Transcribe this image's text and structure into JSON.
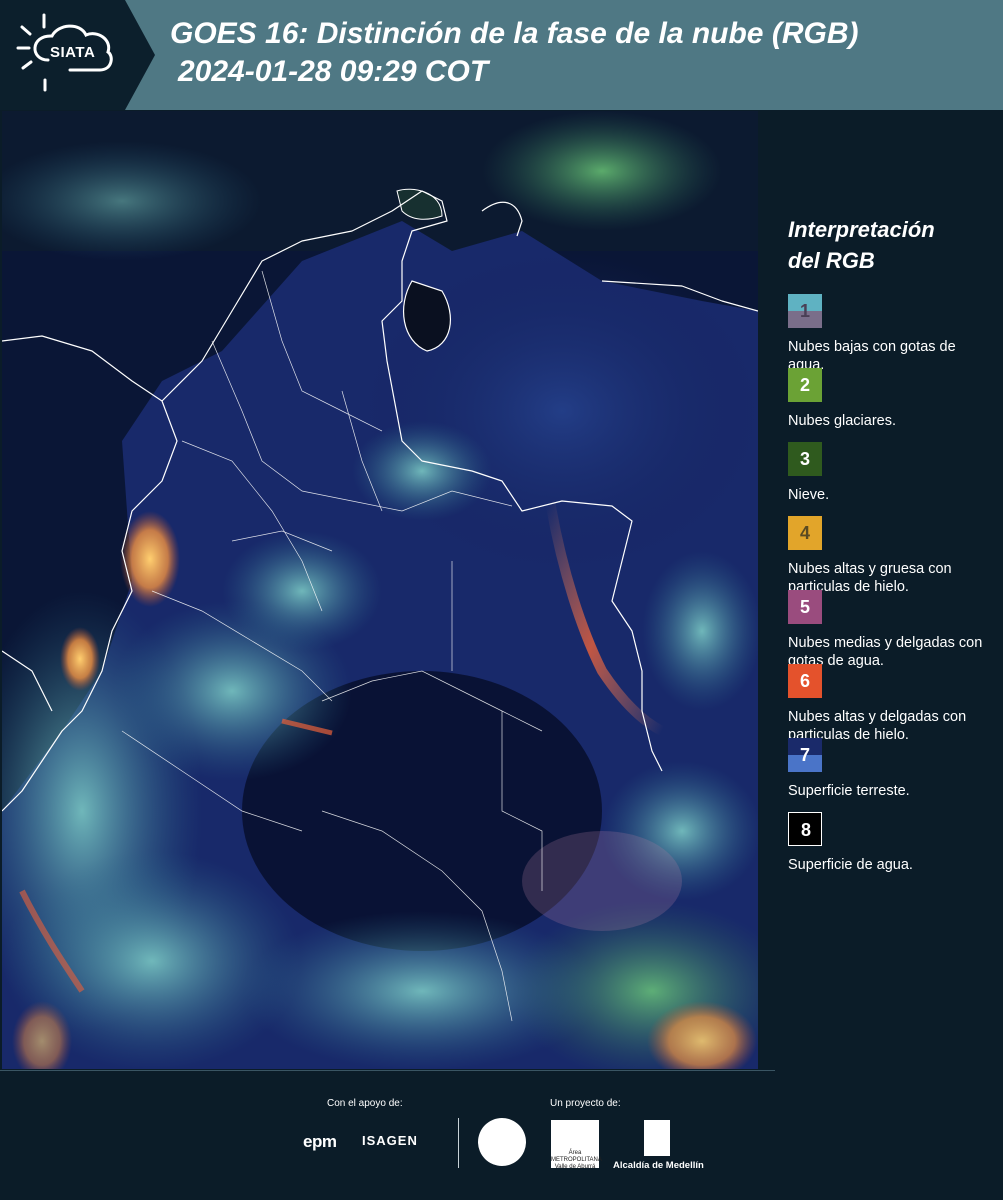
{
  "header": {
    "logo_text": "SIATA",
    "title": "GOES 16: Distinción de la fase de la nube (RGB)",
    "subtitle": "2024-01-28 09:29 COT"
  },
  "legend": {
    "title_line1": "Interpretación",
    "title_line2": "del RGB",
    "items": [
      {
        "number": "1",
        "label": "Nubes bajas con gotas de agua.",
        "color_top": "#5fb2c2",
        "color_bottom": "#7a6e8a",
        "text_color": "#4a3f55"
      },
      {
        "number": "2",
        "label": "Nubes glaciares.",
        "color_top": "#6ba235",
        "color_bottom": "#6ba235",
        "text_color": "#ffffff"
      },
      {
        "number": "3",
        "label": "Nieve.",
        "color_top": "#2f5a1e",
        "color_bottom": "#2f5a1e",
        "text_color": "#ffffff"
      },
      {
        "number": "4",
        "label": "Nubes altas y gruesa con particulas de hielo.",
        "color_top": "#e2a52a",
        "color_bottom": "#e2a52a",
        "text_color": "#5a4a22"
      },
      {
        "number": "5",
        "label": "Nubes medias y delgadas con gotas de agua.",
        "color_top": "#9a4c7e",
        "color_bottom": "#9a4c7e",
        "text_color": "#ffffff"
      },
      {
        "number": "6",
        "label": "Nubes altas y delgadas con particulas de hielo.",
        "color_top": "#e4522c",
        "color_bottom": "#e4522c",
        "text_color": "#ffffff"
      },
      {
        "number": "7",
        "label": "Superficie terreste.",
        "color_top": "#1a2a6a",
        "color_bottom": "#4a74c8",
        "text_color": "#ffffff"
      },
      {
        "number": "8",
        "label": "Superficie de agua.",
        "color_top": "#000000",
        "color_bottom": "#000000",
        "text_color": "#ffffff"
      }
    ]
  },
  "footer": {
    "support_label": "Con el apoyo de:",
    "project_label": "Un proyecto de:",
    "epm": "epm",
    "isagen": "ISAGEN",
    "area_text": "Área METROPOLITANA Valle de Aburrá",
    "medellin": "Alcaldía de Medellín"
  },
  "colors": {
    "header_bg": "#4f7884",
    "page_bg": "#0b1c28"
  }
}
